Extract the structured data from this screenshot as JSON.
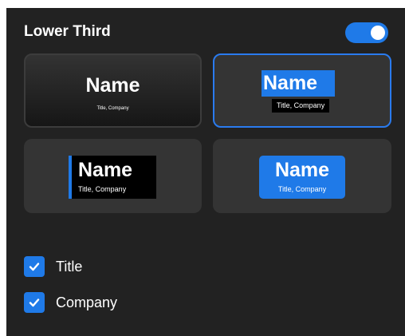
{
  "header": {
    "title": "Lower Third",
    "toggle_on": true
  },
  "styles": [
    {
      "id": "style-1",
      "name": "Name",
      "subtitle": "Title, Company",
      "selected": false
    },
    {
      "id": "style-2",
      "name": "Name",
      "subtitle": "Title, Company",
      "selected": true
    },
    {
      "id": "style-3",
      "name": "Name",
      "subtitle": "Title, Company",
      "selected": false
    },
    {
      "id": "style-4",
      "name": "Name",
      "subtitle": "Title, Company",
      "selected": false
    }
  ],
  "options": [
    {
      "label": "Title",
      "checked": true
    },
    {
      "label": "Company",
      "checked": true
    }
  ],
  "colors": {
    "accent": "#1f7ae8",
    "panel_bg": "#222222",
    "card_bg": "#343434",
    "text": "#ffffff"
  },
  "icons": {
    "checkbox_mark": "check-icon"
  }
}
